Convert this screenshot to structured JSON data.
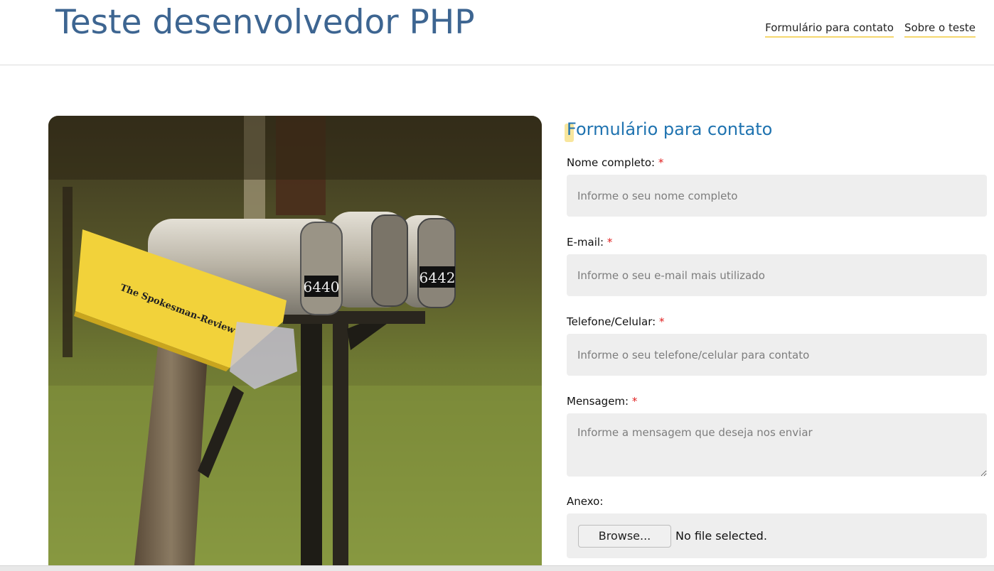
{
  "header": {
    "title": "Teste desenvolvedor PHP",
    "nav": [
      {
        "label": "Formulário para contato"
      },
      {
        "label": "Sobre o teste"
      }
    ]
  },
  "image": {
    "mailbox_numbers": [
      "6440",
      "6442"
    ],
    "newspaper_box_text": "The Spokesman-Review"
  },
  "form": {
    "title": "Formulário para contato",
    "required_mark": "*",
    "fields": {
      "name": {
        "label": "Nome completo:",
        "placeholder": "Informe o seu nome completo"
      },
      "email": {
        "label": "E-mail:",
        "placeholder": "Informe o seu e-mail mais utilizado"
      },
      "phone": {
        "label": "Telefone/Celular:",
        "placeholder": "Informe o seu telefone/celular para contato"
      },
      "message": {
        "label": "Mensagem:",
        "placeholder": "Informe a mensagem que deseja nos enviar"
      }
    },
    "attachment": {
      "label": "Anexo:",
      "button": "Browse...",
      "status": "No file selected."
    }
  },
  "colors": {
    "title": "#3d6591",
    "form_title": "#1f73b0",
    "accent_underline": "#f5d76e",
    "required": "#e02020",
    "field_bg": "#eeeeee"
  }
}
